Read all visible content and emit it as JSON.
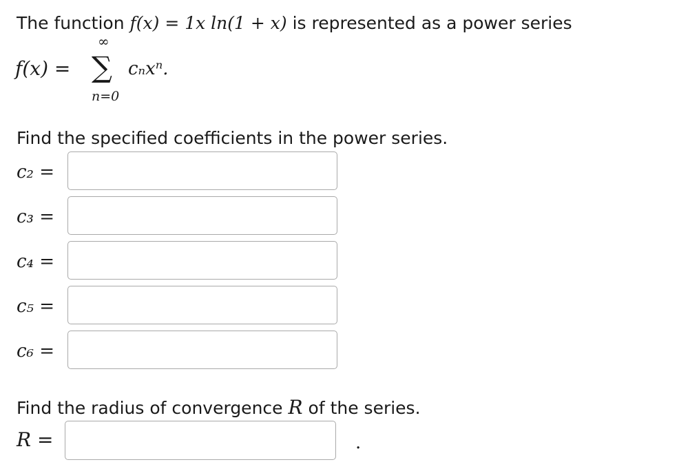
{
  "intro": {
    "prefix": "The function ",
    "func": "f(x) = 1x ln(1 + x)",
    "suffix": " is represented as a power series"
  },
  "series": {
    "lhs": "f(x) = ",
    "sigma": "∑",
    "upper": "∞",
    "lower": "n=0",
    "term": "cₙxⁿ."
  },
  "prompt_coefficients": "Find the specified coefficients in the power series.",
  "coefficients": [
    {
      "label": "c₂ =",
      "value": ""
    },
    {
      "label": "c₃ =",
      "value": ""
    },
    {
      "label": "c₄ =",
      "value": ""
    },
    {
      "label": "c₅ =",
      "value": ""
    },
    {
      "label": "c₆ =",
      "value": ""
    }
  ],
  "prompt_radius": {
    "prefix": "Find the radius of convergence ",
    "symbol": "R",
    "suffix": " of the series."
  },
  "radius": {
    "label": "R =",
    "value": "",
    "trailing": "."
  }
}
